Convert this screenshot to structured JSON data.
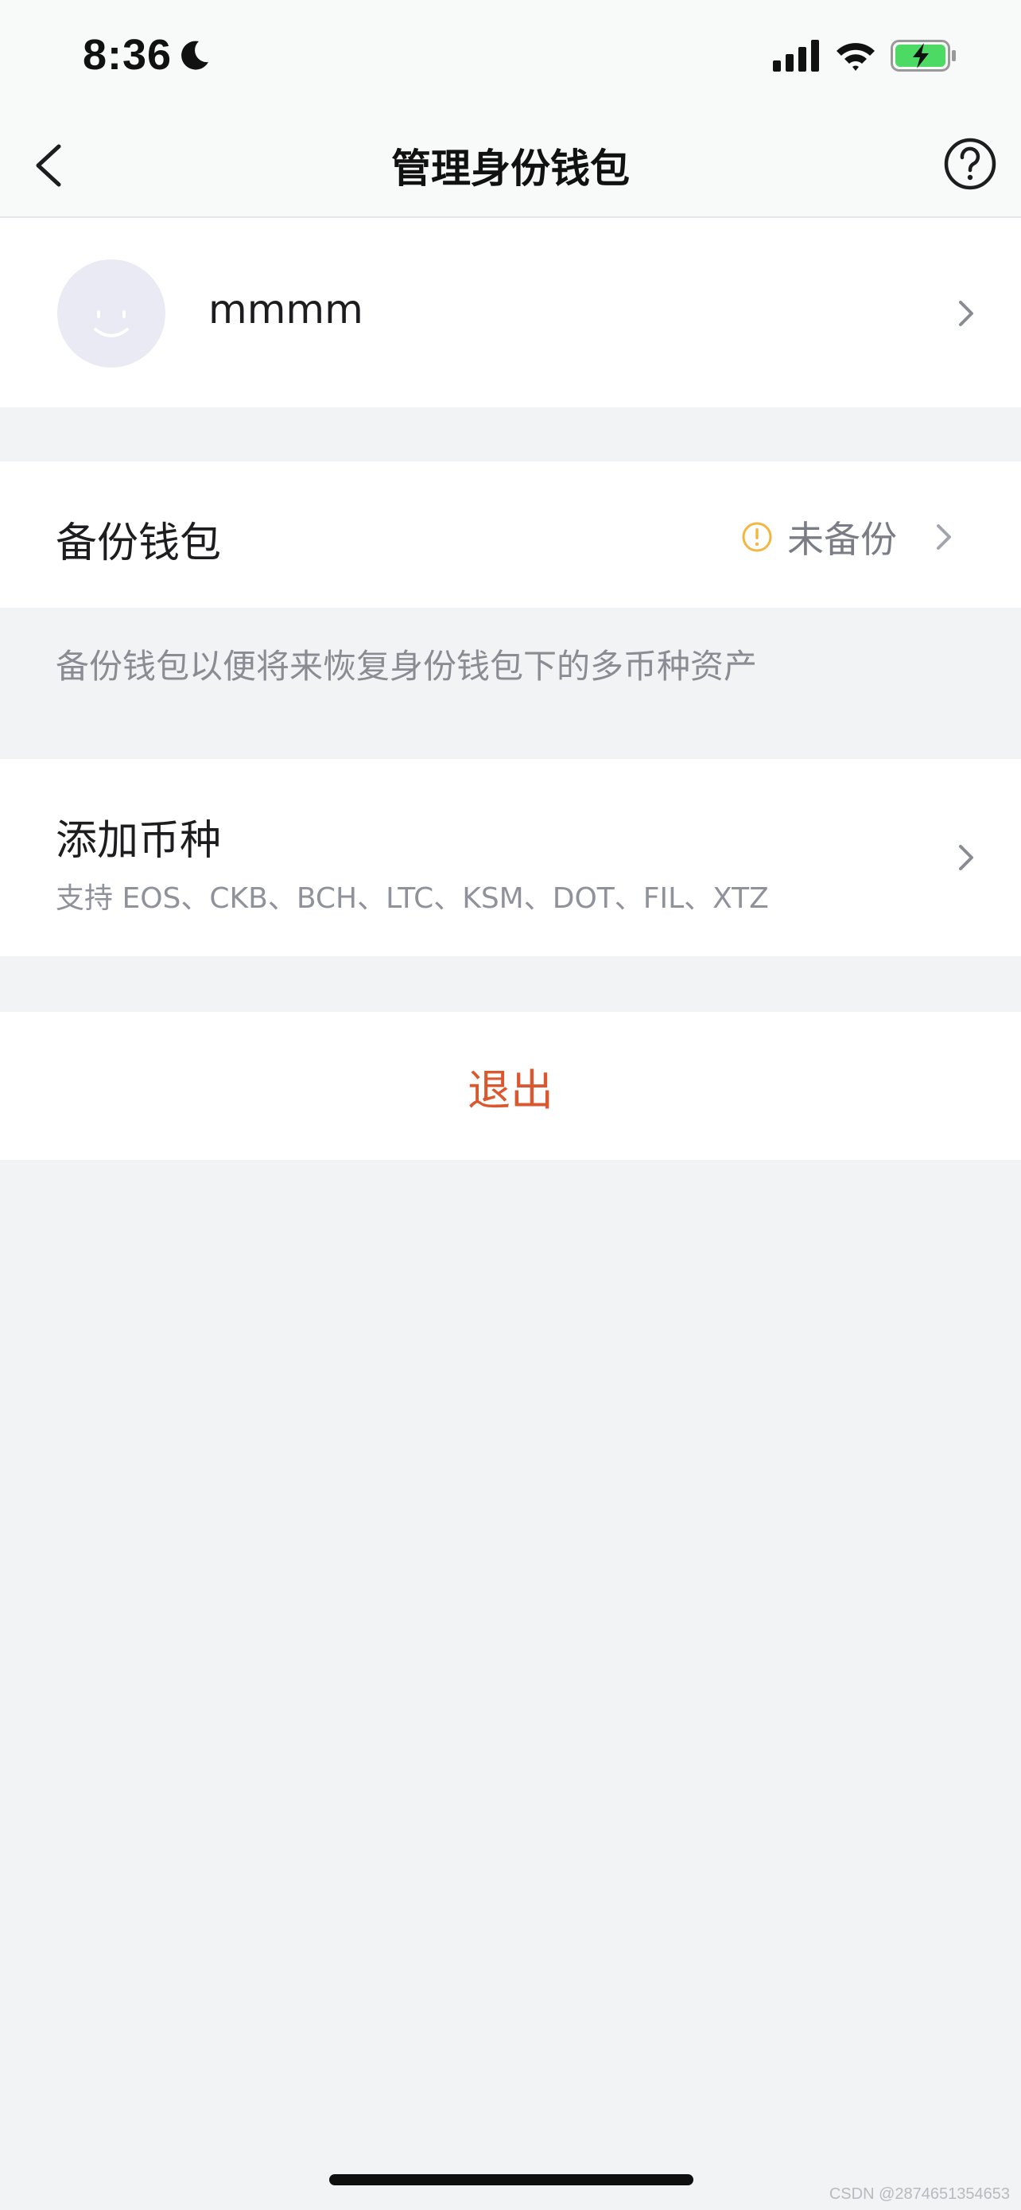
{
  "status_bar": {
    "time": "8:36",
    "moon_icon": "moon-icon",
    "signal_icon": "cellular-signal-icon",
    "wifi_icon": "wifi-icon",
    "battery_icon": "battery-charging-icon",
    "battery_color": "#4cd964"
  },
  "nav": {
    "title": "管理身份钱包",
    "back_icon": "chevron-left-icon",
    "help_icon": "help-circle-icon"
  },
  "profile": {
    "name": "mmmm",
    "avatar_icon": "smiley-face-icon"
  },
  "backup": {
    "title": "备份钱包",
    "status": "未备份",
    "status_icon": "warning-circle-icon",
    "status_icon_color": "#f3b640",
    "description": "备份钱包以便将来恢复身份钱包下的多币种资产"
  },
  "add_coin": {
    "title": "添加币种",
    "subtitle": "支持 EOS、CKB、BCH、LTC、KSM、DOT、FIL、XTZ"
  },
  "logout": {
    "label": "退出",
    "color": "#d9582f"
  },
  "watermark": "CSDN @2874651354653"
}
